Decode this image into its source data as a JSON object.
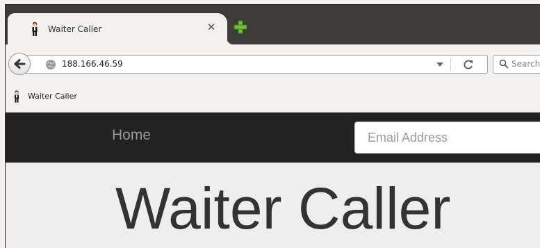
{
  "browser": {
    "tab": {
      "title": "Waiter Caller",
      "favicon": "waiter-icon",
      "close_symbol": "✕"
    },
    "newtab_icon": "plus-icon",
    "address": {
      "url": "188.166.46.59",
      "site_icon": "globe-icon"
    },
    "search": {
      "placeholder": "Search"
    },
    "bookmarks": [
      {
        "label": "Waiter Caller",
        "icon": "waiter-icon"
      }
    ]
  },
  "site": {
    "nav": {
      "home_label": "Home"
    },
    "email_input": {
      "placeholder": "Email Address"
    },
    "heading": "Waiter Caller"
  },
  "colors": {
    "tabstrip": "#3c3b37",
    "navbar_dark": "#222222",
    "newtab_green": "#6fbf3a",
    "page_background": "#eeeeee"
  }
}
